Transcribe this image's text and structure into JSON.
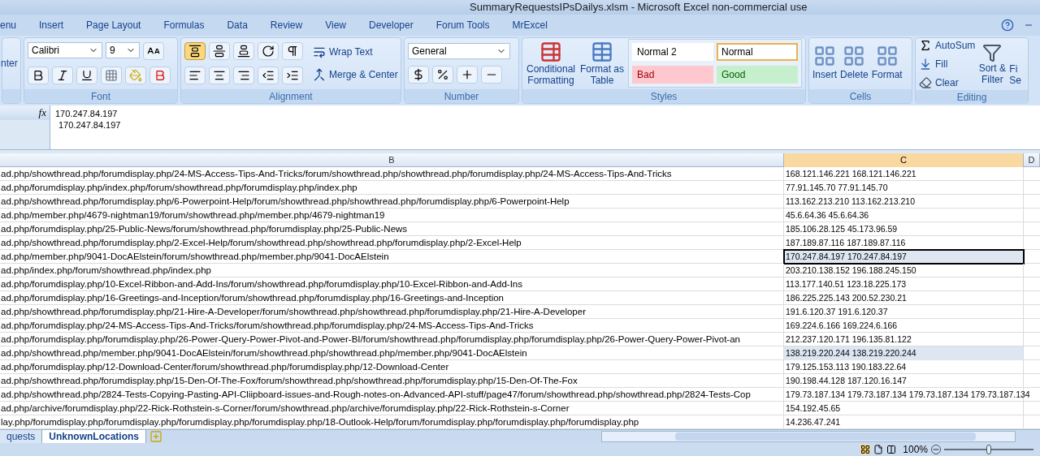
{
  "window": {
    "title": "SummaryRequestsIPsDailys.xlsm - Microsoft Excel non-commercial use"
  },
  "ribbon_tabs": [
    "enu",
    "Insert",
    "Page Layout",
    "Formulas",
    "Data",
    "Review",
    "View",
    "Developer",
    "Forum Tools",
    "MrExcel"
  ],
  "clipboard": {
    "label_fragment": "nter"
  },
  "font": {
    "name": "Calibri",
    "size": "9",
    "label": "Font"
  },
  "alignment": {
    "vertical": [
      {
        "selected": true
      },
      {
        "selected": false
      },
      {
        "selected": false
      }
    ],
    "wrap_text": "Wrap Text",
    "merge": "Merge & Center",
    "label": "Alignment"
  },
  "number": {
    "format": "General",
    "label": "Number"
  },
  "styles": {
    "conditional": "Conditional Formatting",
    "format_table": "Format as Table",
    "cell_styles": [
      {
        "label": "Normal 2",
        "kind": "neutral",
        "color": "#ffffff",
        "selected": false
      },
      {
        "label": "Normal",
        "kind": "neutral",
        "color": "#ffffff",
        "selected": true
      },
      {
        "label": "Bad",
        "kind": "bad",
        "color": "#ffc7ce",
        "selected": false
      },
      {
        "label": "Good",
        "kind": "good",
        "color": "#c6efce",
        "selected": false
      }
    ],
    "label": "Styles"
  },
  "cells": {
    "buttons": [
      "Insert",
      "Delete",
      "Format"
    ],
    "label": "Cells"
  },
  "editing": {
    "autosum": "AutoSum",
    "fill": "Fill",
    "clear": "Clear",
    "sort": "Sort & Filter",
    "find_fragment": [
      "Fi",
      "Se"
    ],
    "label": "Editing"
  },
  "formula_bar": {
    "fx_label": "fx",
    "lines": [
      "170.247.84.197",
      "170.247.84.197"
    ]
  },
  "columns": [
    {
      "label": "B",
      "selected": false
    },
    {
      "label": "C",
      "selected": true
    },
    {
      "label": "D",
      "selected": false
    }
  ],
  "rows": [
    {
      "b": "ad.php/showthread.php/forumdisplay.php/24-MS-Access-Tips-And-Tricks/forum/showthread.php/showthread.php/forumdisplay.php/24-MS-Access-Tips-And-Tricks",
      "c": "168.121.146.221 168.121.146.221",
      "selected": false,
      "highlighted": false
    },
    {
      "b": "ad.php/forumdisplay.php/index.php/forum/showthread.php/forumdisplay.php/index.php",
      "c": "77.91.145.70 77.91.145.70",
      "selected": false,
      "highlighted": false
    },
    {
      "b": "ad.php/showthread.php/forumdisplay.php/6-Powerpoint-Help/forum/showthread.php/showthread.php/forumdisplay.php/6-Powerpoint-Help",
      "c": "113.162.213.210 113.162.213.210",
      "selected": false,
      "highlighted": false
    },
    {
      "b": "ad.php/member.php/4679-nightman19/forum/showthread.php/member.php/4679-nightman19",
      "c": "45.6.64.36 45.6.64.36",
      "selected": false,
      "highlighted": false
    },
    {
      "b": "ad.php/forumdisplay.php/25-Public-News/forum/showthread.php/forumdisplay.php/25-Public-News",
      "c": "185.106.28.125 45.173.96.59",
      "selected": false,
      "highlighted": false
    },
    {
      "b": "ad.php/showthread.php/forumdisplay.php/2-Excel-Help/forum/showthread.php/showthread.php/forumdisplay.php/2-Excel-Help",
      "c": "187.189.87.116 187.189.87.116",
      "selected": false,
      "highlighted": false
    },
    {
      "b": "ad.php/member.php/9041-DocAElstein/forum/showthread.php/member.php/9041-DocAElstein",
      "c": "170.247.84.197 170.247.84.197",
      "selected": true,
      "highlighted": false
    },
    {
      "b": "ad.php/index.php/forum/showthread.php/index.php",
      "c": "203.210.138.152 196.188.245.150",
      "selected": false,
      "highlighted": false
    },
    {
      "b": "ad.php/forumdisplay.php/10-Excel-Ribbon-and-Add-Ins/forum/showthread.php/forumdisplay.php/10-Excel-Ribbon-and-Add-Ins",
      "c": "113.177.140.51 123.18.225.173",
      "selected": false,
      "highlighted": false
    },
    {
      "b": "ad.php/forumdisplay.php/16-Greetings-and-Inception/forum/showthread.php/forumdisplay.php/16-Greetings-and-Inception",
      "c": "186.225.225.143 200.52.230.21",
      "selected": false,
      "highlighted": false
    },
    {
      "b": "ad.php/showthread.php/forumdisplay.php/21-Hire-A-Developer/forum/showthread.php/showthread.php/forumdisplay.php/21-Hire-A-Developer",
      "c": "191.6.120.37 191.6.120.37",
      "selected": false,
      "highlighted": false
    },
    {
      "b": "ad.php/forumdisplay.php/24-MS-Access-Tips-And-Tricks/forum/showthread.php/forumdisplay.php/24-MS-Access-Tips-And-Tricks",
      "c": "169.224.6.166 169.224.6.166",
      "selected": false,
      "highlighted": false
    },
    {
      "b": "ad.php/forumdisplay.php/forumdisplay.php/26-Power-Query-Power-Pivot-and-Power-BI/forum/showthread.php/forumdisplay.php/forumdisplay.php/26-Power-Query-Power-Pivot-an",
      "c": "212.237.120.171 196.135.81.122",
      "selected": false,
      "highlighted": false
    },
    {
      "b": "ad.php/showthread.php/member.php/9041-DocAElstein/forum/showthread.php/showthread.php/member.php/9041-DocAElstein",
      "c": "138.219.220.244 138.219.220.244",
      "selected": false,
      "highlighted": true
    },
    {
      "b": "ad.php/forumdisplay.php/12-Download-Center/forum/showthread.php/forumdisplay.php/12-Download-Center",
      "c": "179.125.153.113 190.183.22.64",
      "selected": false,
      "highlighted": false
    },
    {
      "b": "ad.php/showthread.php/forumdisplay.php/15-Den-Of-The-Fox/forum/showthread.php/showthread.php/forumdisplay.php/15-Den-Of-The-Fox",
      "c": "190.198.44.128 187.120.16.147",
      "selected": false,
      "highlighted": false
    },
    {
      "b": "ad.php/showthread.php/2824-Tests-Copying-Pasting-API-Cliipboard-issues-and-Rough-notes-on-Advanced-API-stuff/page47/forum/showthread.php/showthread.php/2824-Tests-Cop",
      "c": "179.73.187.134 179.73.187.134 179.73.187.134 179.73.187.134",
      "selected": false,
      "highlighted": false
    },
    {
      "b": "ad.php/archive/forumdisplay.php/22-Rick-Rothstein-s-Corner/forum/showthread.php/archive/forumdisplay.php/22-Rick-Rothstein-s-Corner",
      "c": "154.192.45.65",
      "selected": false,
      "highlighted": false
    },
    {
      "b": "lay.php/forumdisplay.php/forumdisplay.php/forumdisplay.php/forumdisplay.php/18-Outlook-Help/forum/forumdisplay.php/forumdisplay.php/forumdisplay.php",
      "c": "14.236.47.241",
      "selected": false,
      "highlighted": false
    }
  ],
  "sheet_tabs": [
    {
      "label": "quests",
      "selected": false
    },
    {
      "label": "UnknownLocations",
      "selected": true
    }
  ],
  "status_bar": {
    "zoom": "100%",
    "zoom_slider": {
      "level": 0.5
    }
  }
}
